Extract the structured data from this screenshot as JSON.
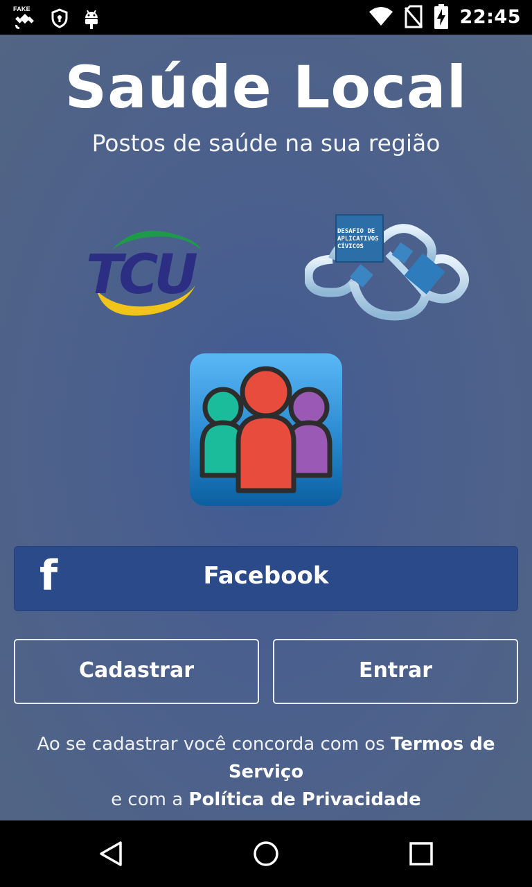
{
  "status_bar": {
    "fake_gps_label": "FAKE",
    "time": "22:45",
    "icons": [
      "fake-gps-icon",
      "shield-icon",
      "android-icon",
      "wifi-icon",
      "no-sim-icon",
      "battery-charging-icon"
    ]
  },
  "app": {
    "title": "Saúde Local",
    "subtitle": "Postos de saúde na sua região"
  },
  "logos": {
    "tcu_text": "TCU",
    "desafio_lines": [
      "DESAFIO DE",
      "APLICATIVOS",
      "CÍVICOS"
    ]
  },
  "buttons": {
    "facebook_icon": "f",
    "facebook": "Facebook",
    "cadastrar": "Cadastrar",
    "entrar": "Entrar"
  },
  "terms": {
    "prefix": "Ao se cadastrar você concorda com os ",
    "terms_link": "Termos de Serviço",
    "middle": "e com a ",
    "privacy_link": "Política de Privacidade"
  },
  "colors": {
    "background": "#4a5f8e",
    "facebook": "#2b4a8a",
    "tcu_blue": "#2c2e84",
    "tcu_green": "#1e9a4a",
    "tcu_yellow": "#f0c419"
  }
}
